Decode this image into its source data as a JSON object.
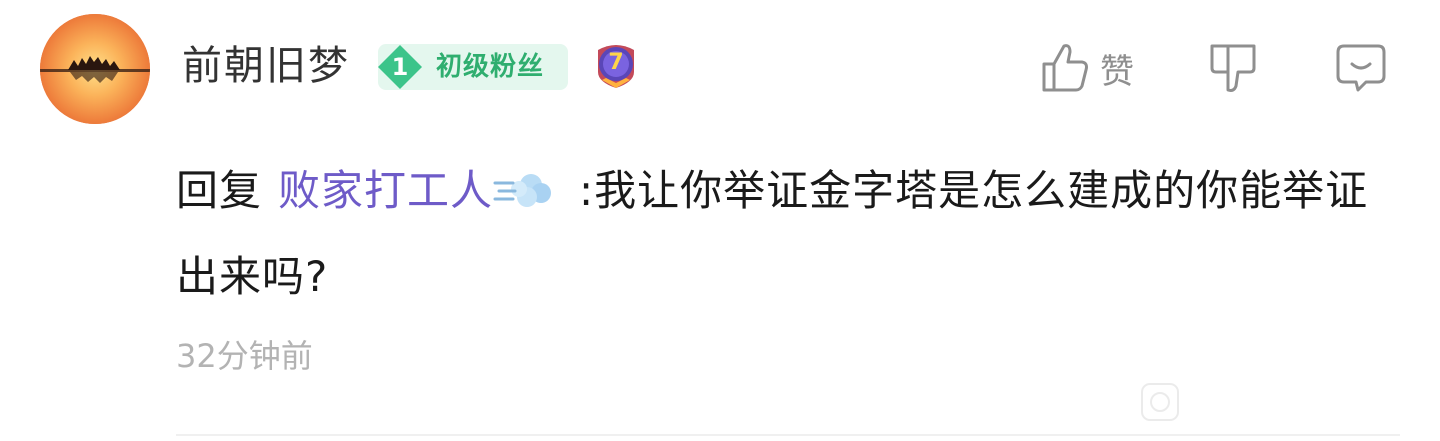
{
  "user": {
    "name": "前朝旧梦",
    "fan_badge_level": "1",
    "fan_badge_label": "初级粉丝",
    "medal_level": "7"
  },
  "actions": {
    "like_label": "赞"
  },
  "comment": {
    "reply_prefix": "回复",
    "mention": "败家打工人",
    "text": ":我让你举证金字塔是怎么建成的你能举证出来吗?"
  },
  "timestamp": "32分钟前",
  "colors": {
    "mention": "#6e5bc8",
    "fan_badge_bg": "#e4f7ee",
    "fan_badge_text": "#2fae6f",
    "muted": "#8f8f8f",
    "timestamp": "#b3b3b3"
  },
  "icons": {
    "like": "thumb-up-icon",
    "dislike": "thumb-down-icon",
    "reply": "comment-bubble-icon",
    "emoji": "dash-emoji-icon"
  }
}
